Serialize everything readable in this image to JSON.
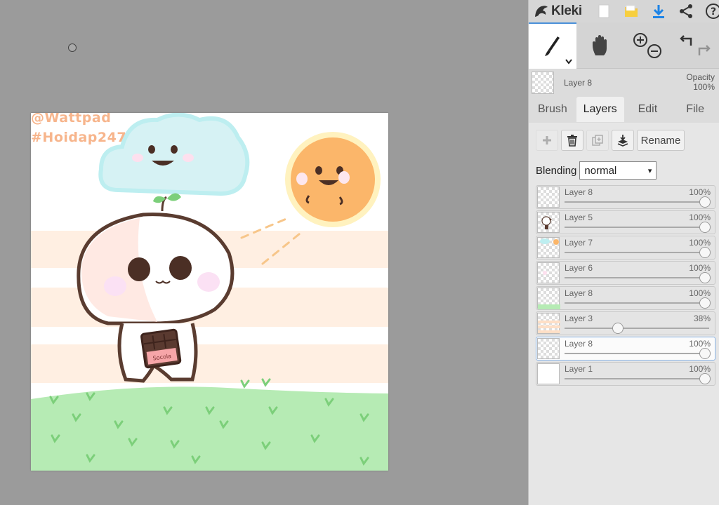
{
  "app": {
    "name": "Kleki"
  },
  "canvas": {
    "watermark_lines": [
      "@Wattpad",
      "#Hoidap247"
    ],
    "chocolate_label": "Socola"
  },
  "current_layer": {
    "name": "Layer 8",
    "opacity_label": "Opacity",
    "opacity_value": "100%"
  },
  "tabs": [
    {
      "label": "Brush"
    },
    {
      "label": "Layers"
    },
    {
      "label": "Edit"
    },
    {
      "label": "File"
    }
  ],
  "active_tab": "Layers",
  "layer_actions": {
    "rename_label": "Rename"
  },
  "blending": {
    "label": "Blending",
    "value": "normal"
  },
  "layers": [
    {
      "name": "Layer 8",
      "opacity": "100%",
      "level": 1.0,
      "preview": "empty"
    },
    {
      "name": "Layer 5",
      "opacity": "100%",
      "level": 1.0,
      "preview": "character"
    },
    {
      "name": "Layer 7",
      "opacity": "100%",
      "level": 1.0,
      "preview": "cloud-sun"
    },
    {
      "name": "Layer 6",
      "opacity": "100%",
      "level": 1.0,
      "preview": "blush"
    },
    {
      "name": "Layer 8",
      "opacity": "100%",
      "level": 1.0,
      "preview": "grass"
    },
    {
      "name": "Layer 3",
      "opacity": "38%",
      "level": 0.38,
      "preview": "stripes"
    },
    {
      "name": "Layer 8",
      "opacity": "100%",
      "level": 1.0,
      "preview": "empty",
      "selected": true
    },
    {
      "name": "Layer 1",
      "opacity": "100%",
      "level": 1.0,
      "preview": "white"
    }
  ],
  "colors": {
    "accent": "#4a90d9",
    "grass": "#b6ebb4",
    "stripe": "#ffefe2",
    "cloud": "#d6f2f4",
    "sun": "#fbb66a",
    "watermark": "#f7b58c"
  },
  "icons": [
    "kleki-logo-icon",
    "new-file-icon",
    "open-folder-icon",
    "download-icon",
    "share-icon",
    "help-icon",
    "brush-icon",
    "hand-icon",
    "zoom-in-icon",
    "zoom-out-icon",
    "undo-icon",
    "redo-icon",
    "add-layer-icon",
    "delete-layer-icon",
    "duplicate-layer-icon",
    "merge-down-icon"
  ]
}
